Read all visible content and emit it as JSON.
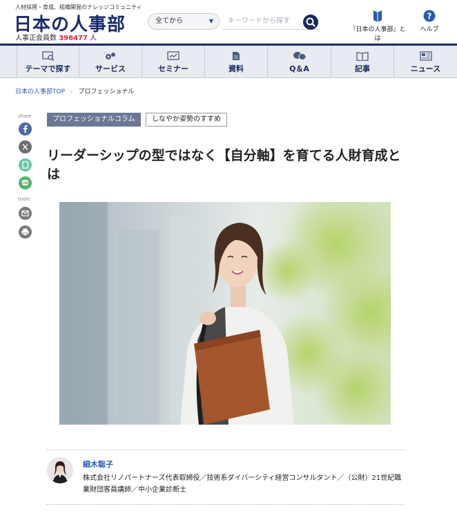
{
  "header": {
    "tagline": "人材採用・育成、組織開発のナレッジコミュニティ",
    "logo": "日本の人事部",
    "member_prefix": "人事正会員数",
    "member_count": "396477",
    "member_suffix": "人",
    "select_value": "全てから",
    "search_placeholder": "キーワードから探す",
    "about_label": "『日本の人事部』とは",
    "help_label": "ヘルプ"
  },
  "nav": {
    "items": [
      {
        "label": "テーマで探す",
        "icon": "search-theme-icon"
      },
      {
        "label": "サービス",
        "icon": "service-icon"
      },
      {
        "label": "セミナー",
        "icon": "seminar-icon"
      },
      {
        "label": "資料",
        "icon": "document-icon"
      },
      {
        "label": "Q＆A",
        "icon": "qa-icon"
      },
      {
        "label": "記事",
        "icon": "article-icon"
      },
      {
        "label": "ニュース",
        "icon": "news-icon"
      }
    ]
  },
  "breadcrumb": {
    "home": "日本の人事部TOP",
    "current": "プロフェッショナル"
  },
  "share": {
    "share_label": "share",
    "tools_label": "tools"
  },
  "article": {
    "tag_primary": "プロフェッショナルコラム",
    "tag_secondary": "しなやか姿勢のすすめ",
    "title": "リーダーシップの型ではなく【自分軸】を育てる人財育成とは"
  },
  "author": {
    "name": "細木聡子",
    "description": "株式会社リノパートナーズ代表取締役／技術系ダイバーシティ経営コンサルタント／（公財）21世紀職業財団客員講師／中小企業診断士"
  },
  "colors": {
    "brand_navy": "#1a2a5a",
    "accent_red": "#d8252e",
    "link_blue": "#2a5aaa",
    "tag_gray": "#6b7794"
  }
}
